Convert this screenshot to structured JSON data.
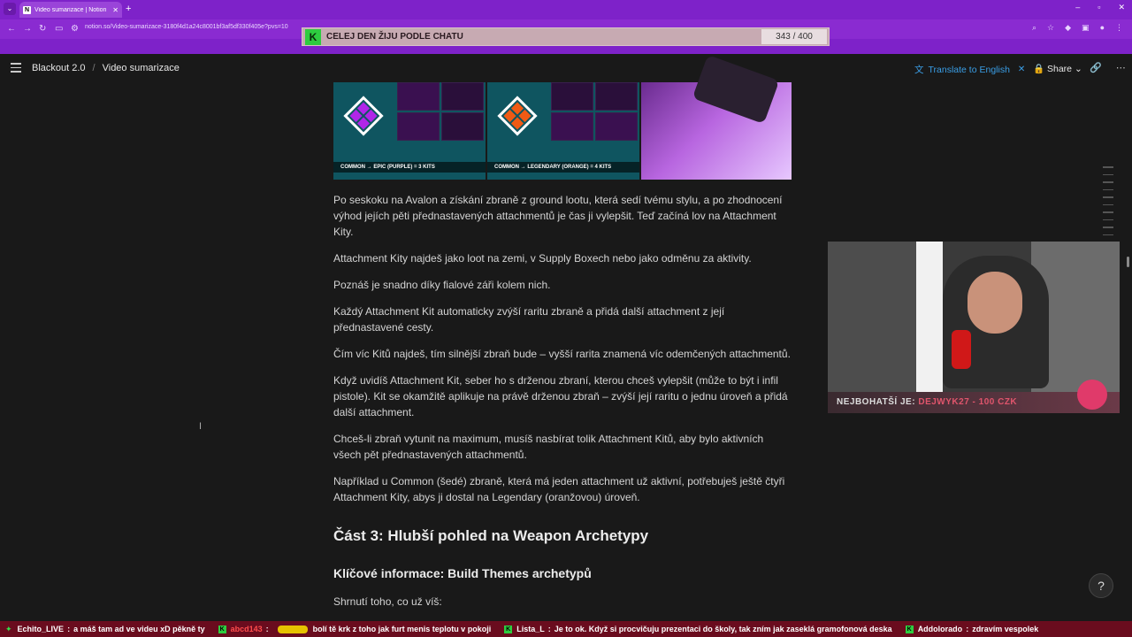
{
  "browser": {
    "tab_title": "Video sumarizace | Notion",
    "tab_favicon": "N",
    "url": "notion.so/Video-sumarizace-3180f4d1a24c8001bf3af5df330f405e?pvs=10"
  },
  "overlay": {
    "banner_text": "CELEJ DEN ŽIJU PODLE CHATU",
    "banner_badge": "K",
    "banner_count": "343 / 400"
  },
  "notion": {
    "breadcrumb": [
      "Blackout 2.0",
      "Video sumarizace"
    ],
    "translate_label": "Translate to English",
    "share_label": "Share"
  },
  "images": {
    "caption_1": "COMMON → EPIC (PURPLE) = 3 KITS",
    "caption_2": "COMMON → LEGENDARY (ORANGE) = 4 KITS",
    "diamond_1_color": "#b026e8",
    "diamond_2_color": "#f05a14"
  },
  "doc": {
    "paragraphs": [
      "Po seskoku na Avalon a získání zbraně z ground lootu, která sedí tvému stylu, a po zhodnocení výhod jejích pěti přednastavených attachmentů je čas ji vylepšit. Teď začíná lov na Attachment Kity.",
      "Attachment Kity najdeš jako loot na zemi, v Supply Boxech nebo jako odměnu za aktivity.",
      "Poznáš je snadno díky fialové záři kolem nich.",
      "Každý Attachment Kit automaticky zvýší raritu zbraně a přidá další attachment z její přednastavené cesty.",
      "Čím víc Kitů najdeš, tím silnější zbraň bude – vyšší rarita znamená víc odemčených attachmentů.",
      "Když uvidíš Attachment Kit, seber ho s drženou zbraní, kterou chceš vylepšit (může to být i infil pistole). Kit se okamžitě aplikuje na právě drženou zbraň – zvýší její raritu o jednu úroveň a přidá další attachment.",
      "Chceš-li zbraň vytunit na maximum, musíš nasbírat tolik Attachment Kitů, aby bylo aktivních všech pět přednastavených attachmentů.",
      "Například u Common (šedé) zbraně, která má jeden attachment už aktivní, potřebuješ ještě čtyři Attachment Kity, abys ji dostal na Legendary (oranžovou) úroveň."
    ],
    "heading_2": "Část 3: Hlubší pohled na Weapon Archetypy",
    "heading_3": "Klíčové informace: Build Themes archetypů",
    "last_paragraph": "Shrnutí toho, co už víš:"
  },
  "webcam": {
    "label_prefix": "NEJBOHATŠÍ JE:",
    "label_name": "DEJWYK27 - 100 CZK"
  },
  "help_button": "?",
  "ticker": [
    {
      "user": "Echito_LIVE",
      "msg": "a máš tam ad ve videu xD pěkně ty"
    },
    {
      "user": "abcd143",
      "msg": "bolí tě krk z toho jak furt menis teplotu v pokoji"
    },
    {
      "user": "Lista_L",
      "msg": "Je to ok. Když si procvičuju prezentaci do školy, tak zním jak zaseklá gramofonová deska"
    },
    {
      "user": "Addolorado",
      "msg": "zdravím vespolek"
    }
  ]
}
